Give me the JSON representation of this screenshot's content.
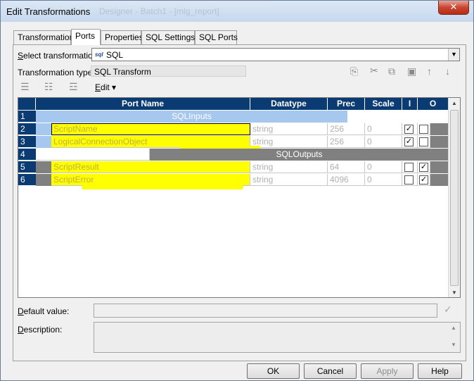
{
  "window": {
    "title": "Edit Transformations",
    "ghost_title": "Designer - Batch1 - [mlg_report]",
    "close_label": "✕"
  },
  "tabs": [
    {
      "label": "Transformation",
      "active": false
    },
    {
      "label": "Ports",
      "active": true
    },
    {
      "label": "Properties",
      "active": false
    },
    {
      "label": "SQL Settings",
      "active": false
    },
    {
      "label": "SQL Ports",
      "active": false
    }
  ],
  "select_transformation": {
    "label": "Select transformation:",
    "icon": "sql",
    "value": "SQL"
  },
  "transformation_type": {
    "label": "Transformation type:",
    "value": "SQL Transform"
  },
  "toolbar": {
    "edit_label": "Edit",
    "icons": [
      "new-port-icon",
      "cut-icon",
      "copy-icon",
      "paste-icon",
      "move-up-icon",
      "move-down-icon"
    ],
    "left_icons": [
      "add-port-icon",
      "add-group-icon",
      "remove-port-icon"
    ]
  },
  "grid": {
    "headers": [
      "Port Name",
      "Datatype",
      "Prec",
      "Scale",
      "I",
      "O"
    ],
    "rows": [
      {
        "num": "1",
        "group": "SQLInputs"
      },
      {
        "num": "2",
        "name": "ScriptName",
        "datatype": "string",
        "prec": "256",
        "scale": "0",
        "i": true,
        "o": false
      },
      {
        "num": "3",
        "name": "LogicalConnectionObject",
        "datatype": "string",
        "prec": "256",
        "scale": "0",
        "i": true,
        "o": false
      },
      {
        "num": "4",
        "group": "SQLOutputs"
      },
      {
        "num": "5",
        "name": "ScriptResult",
        "datatype": "string",
        "prec": "64",
        "scale": "0",
        "i": false,
        "o": true
      },
      {
        "num": "6",
        "name": "ScriptError",
        "datatype": "string",
        "prec": "4096",
        "scale": "0",
        "i": false,
        "o": true
      }
    ]
  },
  "default_value": {
    "label": "Default value:",
    "value": ""
  },
  "description": {
    "label": "Description:",
    "value": ""
  },
  "buttons": {
    "ok": "OK",
    "cancel": "Cancel",
    "apply": "Apply",
    "help": "Help"
  },
  "colors": {
    "grid_header": "#0a3b73",
    "highlight": "#ffff00",
    "input_group": "#a7c8ee",
    "output_group": "#808080"
  }
}
